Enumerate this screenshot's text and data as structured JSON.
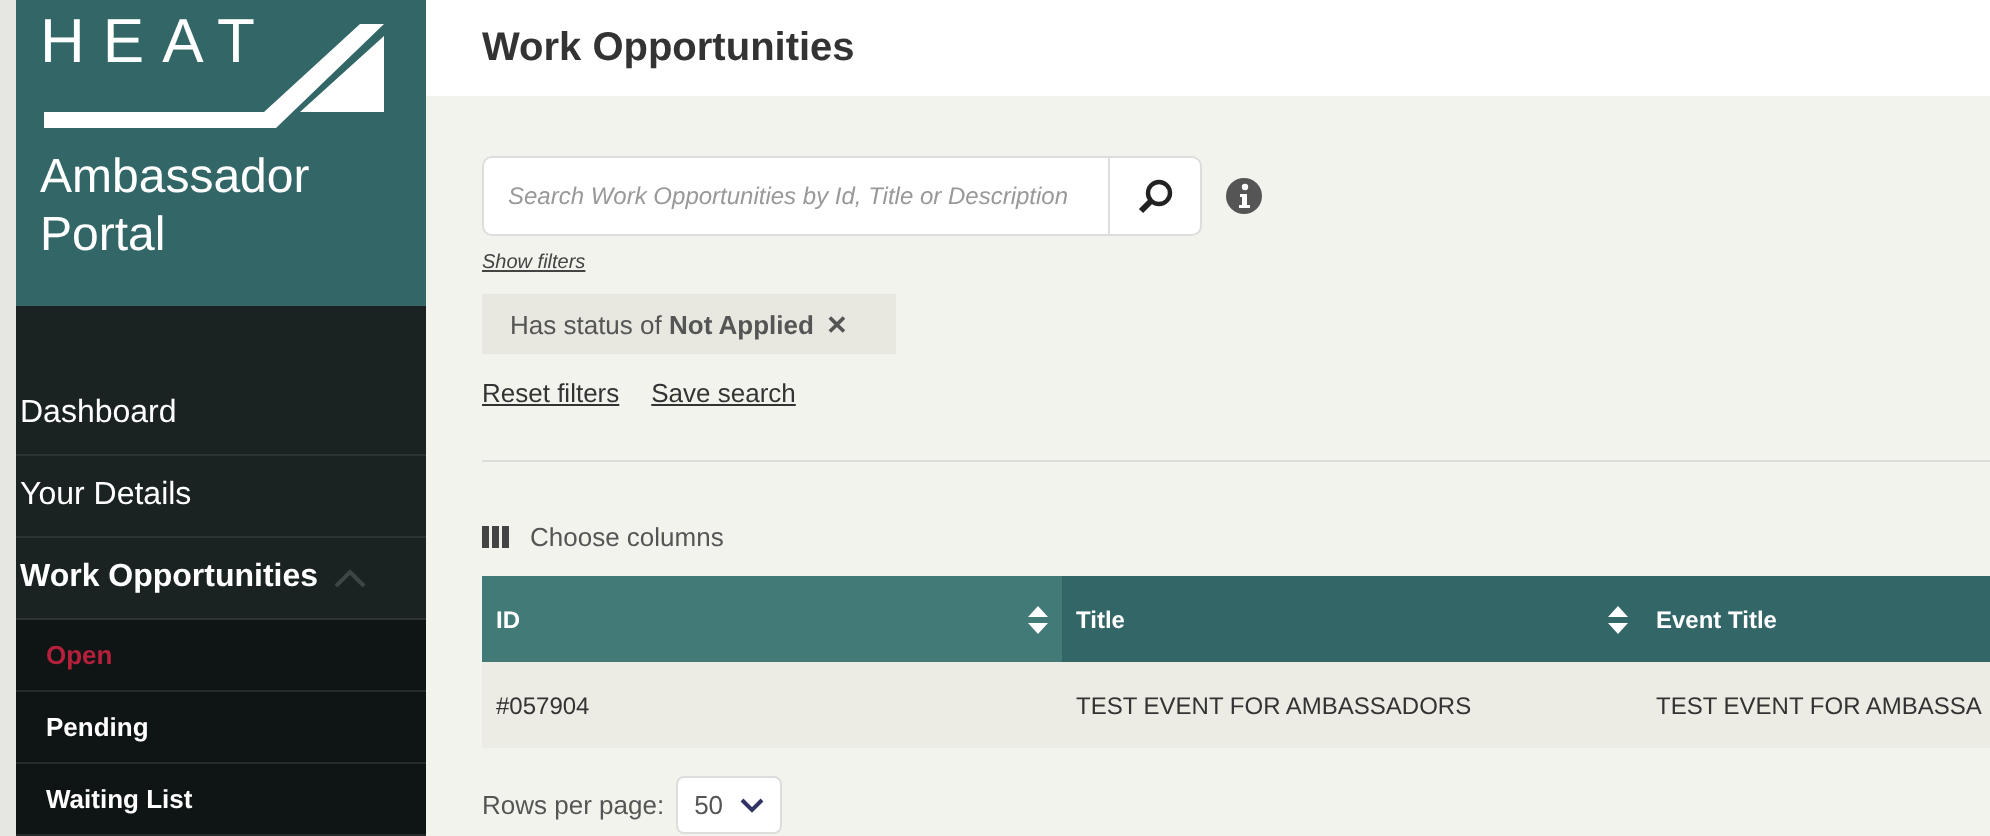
{
  "sidebar": {
    "logo": {
      "word": "HEAT",
      "subtitle": "Ambassador Portal"
    },
    "items": [
      {
        "label": "Dashboard",
        "selected": false
      },
      {
        "label": "Your Details",
        "selected": false
      },
      {
        "label": "Work Opportunities",
        "selected": false,
        "expanded": true,
        "children": [
          {
            "label": "Open",
            "selected": true
          },
          {
            "label": "Pending",
            "selected": false
          },
          {
            "label": "Waiting List",
            "selected": false
          }
        ]
      }
    ]
  },
  "page": {
    "title": "Work Opportunities"
  },
  "search": {
    "placeholder": "Search Work Opportunities by Id, Title or Description"
  },
  "show_filters": "Show filters",
  "filter_chip": {
    "text": "Has status of **Not Applied**",
    "remove": "✕"
  },
  "links": [
    "Reset filters",
    "Save search"
  ],
  "choose_columns": "Choose columns",
  "table": {
    "columns": [
      {
        "label": "ID",
        "sortable": true,
        "selected": true
      },
      {
        "label": "Title",
        "sortable": true,
        "selected": false
      },
      {
        "label": "Event Title",
        "selected": false
      }
    ],
    "rows": [
      [
        "#057904",
        "TEST EVENT FOR AMBASSADORS",
        "TEST EVENT FOR AMBASSA"
      ]
    ]
  },
  "pagination": {
    "label": "Rows per page:",
    "value": "50"
  }
}
